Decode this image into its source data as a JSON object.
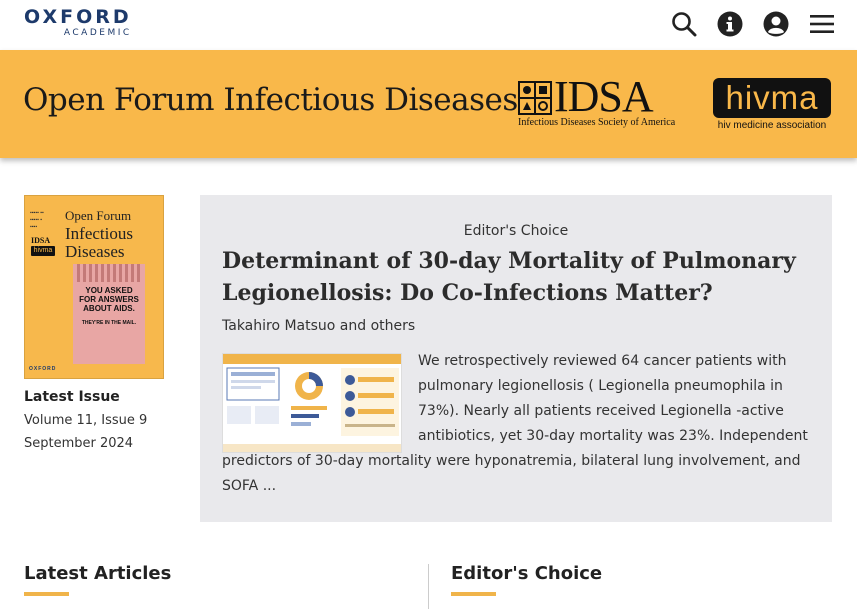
{
  "nav": {
    "logo_line1": "OXFORD",
    "logo_line2": "ACADEMIC",
    "icons": [
      "search-icon",
      "info-icon",
      "user-account-icon",
      "menu-icon"
    ]
  },
  "banner": {
    "journal_title": "Open Forum Infectious Diseases",
    "idsa_word": "IDSA",
    "idsa_subtitle": "Infectious Diseases Society of America",
    "hivma_word": "hivma",
    "hivma_subtitle": "hiv medicine association",
    "background_color": "#f9b84a"
  },
  "issue": {
    "cover_title_line1": "Open Forum",
    "cover_title_line2": "Infectious",
    "cover_title_line3": "Diseases",
    "cover_poster_headline": "YOU ASKED FOR ANSWERS ABOUT AIDS.",
    "cover_poster_sub": "THEY'RE IN THE MAIL.",
    "label": "Latest Issue",
    "volume": "Volume 11, Issue 9",
    "date": "September 2024"
  },
  "featured": {
    "section_label": "Editor's Choice",
    "title": "Determinant of 30-day Mortality of Pulmonary Legionellosis: Do Co-Infections Matter?",
    "authors": "Takahiro Matsuo and others",
    "abstract": "We retrospectively reviewed 64 cancer patients with pulmonary legionellosis ( Legionella pneumophila in 73%). Nearly all patients received Legionella -active antibiotics, yet 30-day mortality was 23%. Independent predictors of 30-day mortality were hyponatremia, bilateral lung involvement, and SOFA ..."
  },
  "sections": {
    "latest_articles": "Latest Articles",
    "editors_choice": "Editor's Choice",
    "accent_color": "#f0b44a"
  }
}
